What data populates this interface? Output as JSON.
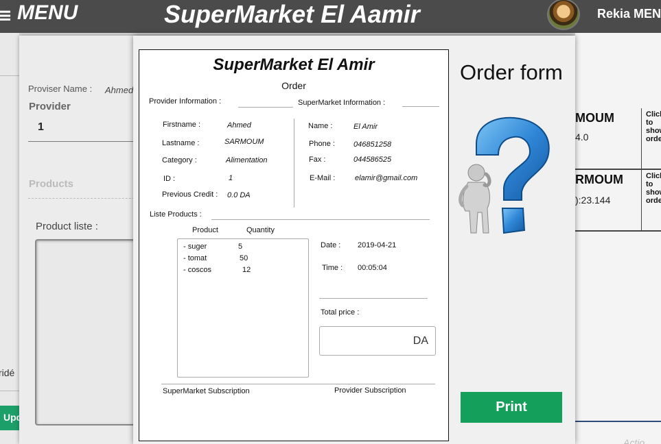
{
  "topbar": {
    "menu_icon": "≡",
    "menu_label": "MENU",
    "app_title": "SuperMarket El Aamir",
    "user_name": "Rekia MEN"
  },
  "background": {
    "left_text": "ridé",
    "left_button": "Upd",
    "proviser_name_label": "Proviser Name :",
    "proviser_name_value": "Ahmed",
    "provider_label": "Provider",
    "provider_value": "1",
    "products_label": "Products",
    "product_liste_label": "Product liste :",
    "right_rows": [
      {
        "name": "MOUM",
        "value": "4.0",
        "action": "Click to show order"
      },
      {
        "name": "RMOUM",
        "value": "):23.144",
        "action": "Click to show order"
      }
    ],
    "right_faint_text": "Actio"
  },
  "modal": {
    "paper": {
      "title": "SuperMarket  El Amir",
      "subtitle": "Order",
      "provider_info_label": "Provider Information :",
      "supermarket_info_label": "SuperMarket Information :",
      "provider": {
        "firstname_label": "Firstname :",
        "firstname": "Ahmed",
        "lastname_label": "Lastname :",
        "lastname": "SARMOUM",
        "category_label": "Category :",
        "category": "Alimentation",
        "id_label": "ID :",
        "id": "1",
        "credit_label": "Previous Credit :",
        "credit": "0.0 DA"
      },
      "supermarket": {
        "name_label": "Name :",
        "name": "El Amir",
        "phone_label": "Phone :",
        "phone": "046851258",
        "fax_label": "Fax :",
        "fax": "044586525",
        "email_label": "E-Mail :",
        "email": "elamir@gmail.com"
      },
      "liste_products_label": "Liste Products :",
      "col_product": "Product",
      "col_quantity": "Quantity",
      "products": [
        {
          "name": "- suger",
          "qty": "5"
        },
        {
          "name": "- tomat",
          "qty": "50"
        },
        {
          "name": "- coscos",
          "qty": "12"
        }
      ],
      "date_label": "Date :",
      "date": "2019-04-21",
      "time_label": "Time :",
      "time": "00:05:04",
      "total_price_label": "Total price :",
      "total_price_value": "",
      "currency": "DA",
      "supermarket_subscription": "SuperMarket Subscription",
      "provider_subscription": "Provider Subscription"
    },
    "order_form_title": "Order form",
    "print_label": "Print",
    "illustration_icon": "question-mark-figure-icon"
  },
  "colors": {
    "topbar": "#4b4b4b",
    "print_button": "#14a05a",
    "question_mark": "#2f86d6"
  }
}
